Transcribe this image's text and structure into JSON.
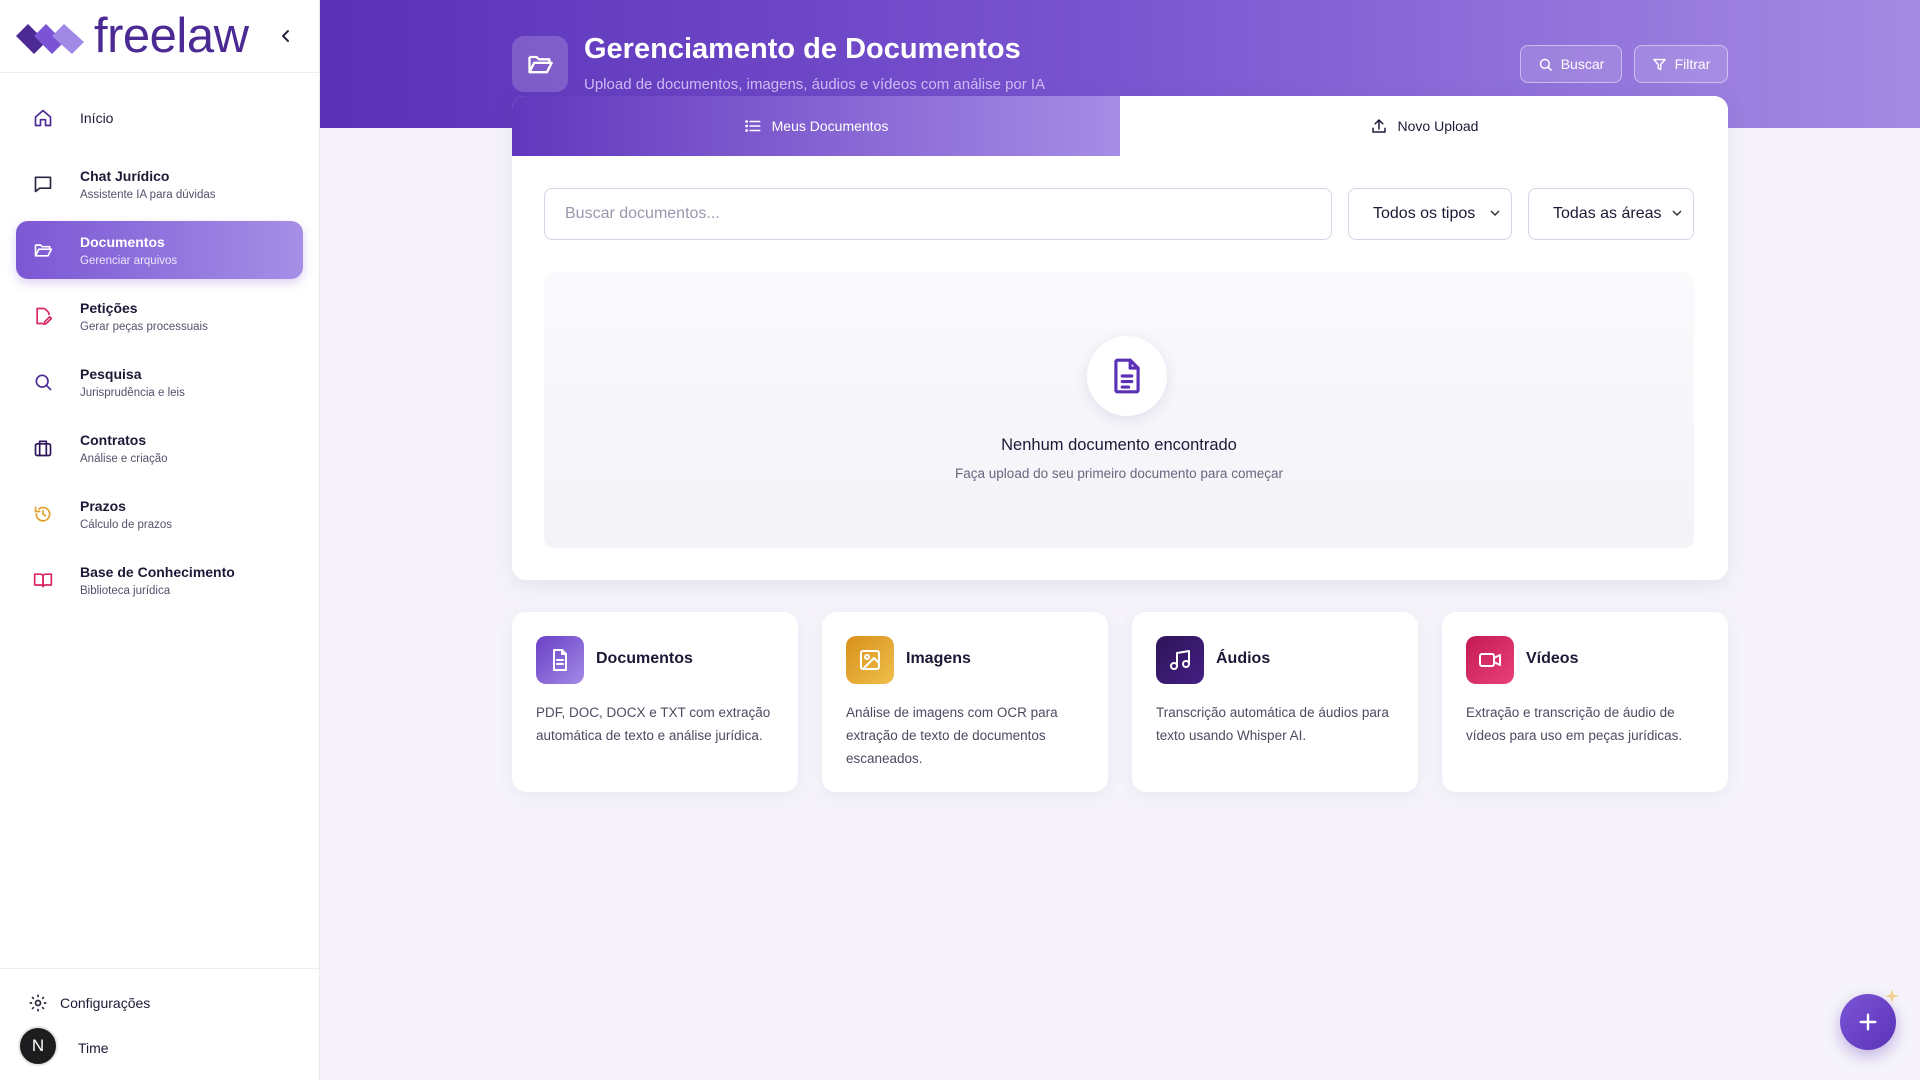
{
  "brand": {
    "name": "freelaw"
  },
  "sidebar": {
    "items": [
      {
        "label": "Início",
        "sub": ""
      },
      {
        "label": "Chat Jurídico",
        "sub": "Assistente IA para dúvidas"
      },
      {
        "label": "Documentos",
        "sub": "Gerenciar arquivos"
      },
      {
        "label": "Petições",
        "sub": "Gerar peças processuais"
      },
      {
        "label": "Pesquisa",
        "sub": "Jurisprudência e leis"
      },
      {
        "label": "Contratos",
        "sub": "Análise e criação"
      },
      {
        "label": "Prazos",
        "sub": "Cálculo de prazos"
      },
      {
        "label": "Base de Conhecimento",
        "sub": "Biblioteca jurídica"
      }
    ],
    "active_index": 2,
    "footer": {
      "settings": "Configurações",
      "user_initial": "N",
      "user_name": "Time"
    }
  },
  "header": {
    "title": "Gerenciamento de Documentos",
    "subtitle": "Upload de documentos, imagens, áudios e vídeos com análise por IA",
    "search_button": "Buscar",
    "filter_button": "Filtrar"
  },
  "tabs": [
    {
      "label": "Meus Documentos",
      "active": true
    },
    {
      "label": "Novo Upload",
      "active": false
    }
  ],
  "filters": {
    "search_placeholder": "Buscar documentos...",
    "type_select": "Todos os tipos",
    "area_select": "Todas as áreas"
  },
  "empty_state": {
    "title": "Nenhum documento encontrado",
    "subtitle": "Faça upload do seu primeiro documento para começar"
  },
  "features": [
    {
      "title": "Documentos",
      "desc": "PDF, DOC, DOCX e TXT com extração automática de texto e análise jurídica.",
      "icon": "document-icon",
      "color": "#7b54d6"
    },
    {
      "title": "Imagens",
      "desc": "Análise de imagens com OCR para extração de texto de documentos escaneados.",
      "icon": "image-icon",
      "color": "#e2a12a"
    },
    {
      "title": "Áudios",
      "desc": "Transcrição automática de áudios para texto usando Whisper AI.",
      "icon": "music-note-icon",
      "color": "#2d1458"
    },
    {
      "title": "Vídeos",
      "desc": "Extração e transcrição de áudio de vídeos para uso em peças jurídicas.",
      "icon": "video-icon",
      "color": "#d8285f"
    }
  ],
  "colors": {
    "primary": "#6237bd",
    "accent_light": "#a68de6",
    "text": "#1e1836"
  }
}
